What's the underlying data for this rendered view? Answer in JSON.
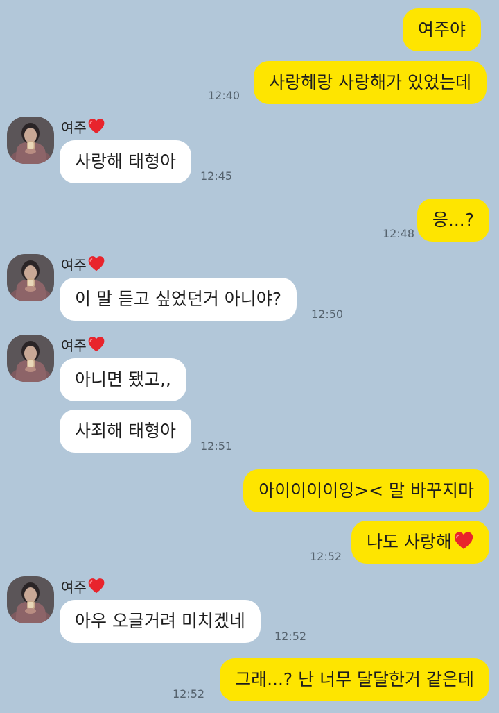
{
  "chat": {
    "contact_name": "여주",
    "messages": [
      {
        "from": "me",
        "text": "여주야"
      },
      {
        "from": "me",
        "text": "사랑헤랑 사랑해가 있었는데",
        "time": "12:40"
      },
      {
        "from": "other",
        "text": "사랑해 태형아",
        "time": "12:45"
      },
      {
        "from": "me",
        "text": "응...?",
        "time": "12:48"
      },
      {
        "from": "other",
        "text": "이 말 듣고 싶었던거 아니야?",
        "time": "12:50"
      },
      {
        "from": "other",
        "text": "아니면 됐고,,"
      },
      {
        "from": "other",
        "text": "사죄해 태형아",
        "time": "12:51"
      },
      {
        "from": "me",
        "text": "아이이이이잉>< 말 바꾸지마"
      },
      {
        "from": "me",
        "text": "나도 사랑해",
        "emoji": "red-heart",
        "time": "12:52"
      },
      {
        "from": "other",
        "text": "아우 오글거려 미치겠네",
        "time": "12:52"
      },
      {
        "from": "me",
        "text": "그래...? 난 너무 달달한거 같은데",
        "time": "12:52"
      }
    ]
  },
  "colors": {
    "background": "#b2c7d9",
    "my_bubble": "#fee500",
    "their_bubble": "#ffffff",
    "heart": "#e8242c"
  },
  "icons": {
    "name_suffix": "red-heart-icon",
    "avatar": "profile-photo"
  }
}
